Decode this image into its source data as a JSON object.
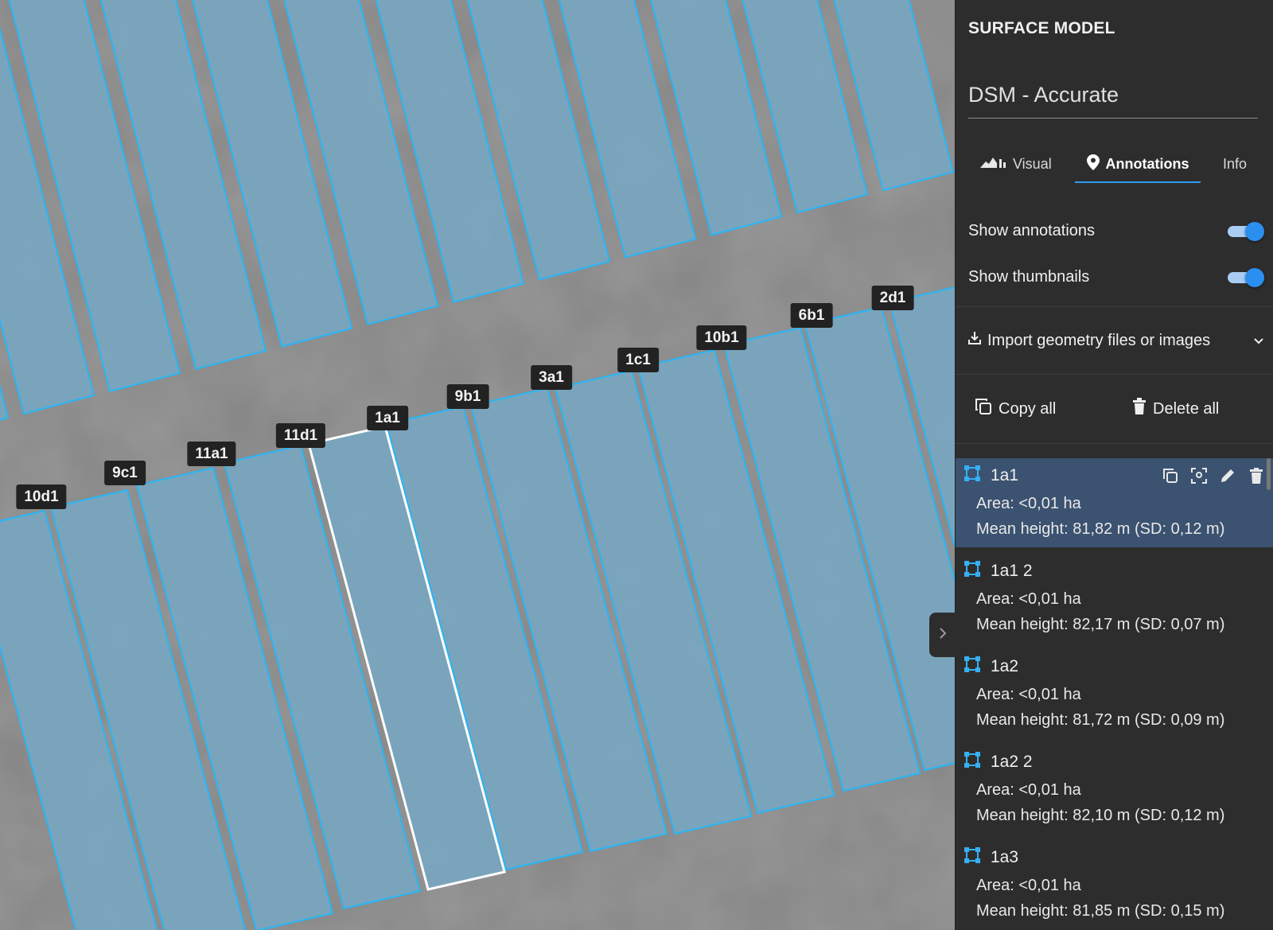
{
  "panel": {
    "title": "SURFACE MODEL",
    "model": "DSM - Accurate",
    "tabs": [
      {
        "label": "Visual",
        "icon": "chart-area-icon",
        "active": false
      },
      {
        "label": "Annotations",
        "icon": "map-pin-icon",
        "active": true
      },
      {
        "label": "Info",
        "icon": "",
        "active": false
      }
    ],
    "toggles": [
      {
        "label": "Show annotations",
        "on": true
      },
      {
        "label": "Show thumbnails",
        "on": true
      }
    ],
    "import_label": "Import geometry files or images",
    "copy_all_label": "Copy all",
    "delete_all_label": "Delete all",
    "annotations": [
      {
        "name": "1a1",
        "area": "Area: <0,01 ha",
        "height": "Mean height: 81,82 m (SD: 0,12 m)",
        "selected": true
      },
      {
        "name": "1a1 2",
        "area": "Area: <0,01 ha",
        "height": "Mean height: 82,17 m (SD: 0,07 m)",
        "selected": false
      },
      {
        "name": "1a2",
        "area": "Area: <0,01 ha",
        "height": "Mean height: 81,72 m (SD: 0,09 m)",
        "selected": false
      },
      {
        "name": "1a2 2",
        "area": "Area: <0,01 ha",
        "height": "Mean height: 82,10 m (SD: 0,12 m)",
        "selected": false
      },
      {
        "name": "1a3",
        "area": "Area: <0,01 ha",
        "height": "Mean height: 81,85 m (SD: 0,15 m)",
        "selected": false
      }
    ]
  },
  "map": {
    "plot_labels": [
      "10d1",
      "9c1",
      "11a1",
      "11d1",
      "1a1",
      "9b1",
      "3a1",
      "1c1",
      "10b1",
      "6b1",
      "2d1"
    ],
    "selected_plot": "1a1",
    "colors": {
      "plot_fill": "#78a6c0",
      "plot_stroke": "#29b6f6",
      "selected_stroke": "#ffffff",
      "ground": "#858585"
    }
  }
}
